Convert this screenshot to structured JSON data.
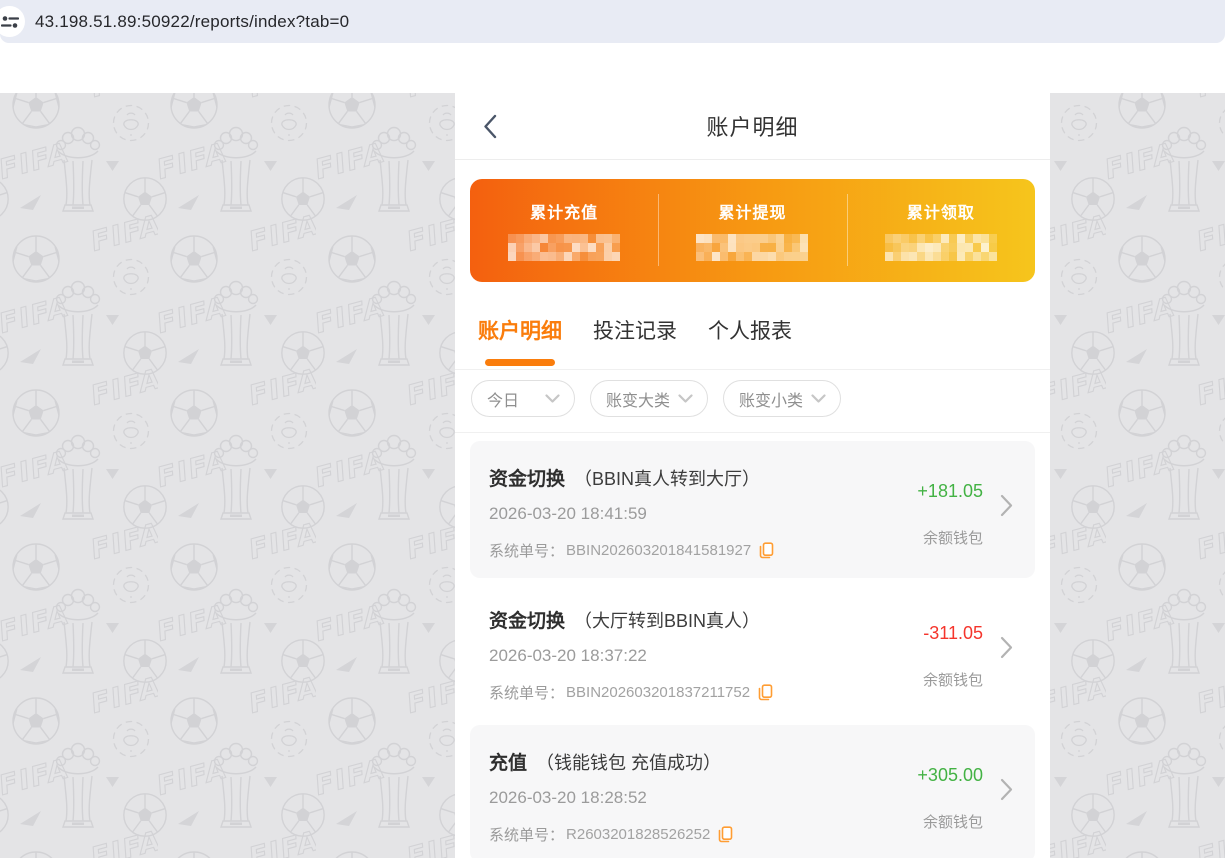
{
  "browser": {
    "url": "43.198.51.89:50922/reports/index?tab=0",
    "bar_color": "#e8ebf4"
  },
  "header": {
    "title": "账户明细"
  },
  "summary": {
    "items": [
      {
        "label": "累计充值",
        "value_redacted": true
      },
      {
        "label": "累计提现",
        "value_redacted": true
      },
      {
        "label": "累计领取",
        "value_redacted": true
      }
    ],
    "gradient_start": "#f4600f",
    "gradient_end": "#f6c51c"
  },
  "tabs": [
    {
      "label": "账户明细",
      "active": true
    },
    {
      "label": "投注记录",
      "active": false
    },
    {
      "label": "个人报表",
      "active": false
    }
  ],
  "filters": [
    {
      "label": "今日"
    },
    {
      "label": "账变大类"
    },
    {
      "label": "账变小类"
    }
  ],
  "transactions": [
    {
      "type": "资金切换",
      "detail": "（BBIN真人转到大厅）",
      "datetime": "2026-03-20 18:41:59",
      "order_label": "系统单号：",
      "order_no": "BBIN202603201841581927",
      "amount": "+181.05",
      "amount_color": "#43b244",
      "wallet": "余额钱包"
    },
    {
      "type": "资金切换",
      "detail": "（大厅转到BBIN真人）",
      "datetime": "2026-03-20 18:37:22",
      "order_label": "系统单号：",
      "order_no": "BBIN202603201837211752",
      "amount": "-311.05",
      "amount_color": "#f5352c",
      "wallet": "余额钱包"
    },
    {
      "type": "充值",
      "detail": "（钱能钱包 充值成功）",
      "datetime": "2026-03-20 18:28:52",
      "order_label": "系统单号：",
      "order_no": "R2603201828526252",
      "amount": "+305.00",
      "amount_color": "#43b244",
      "wallet": "余额钱包"
    }
  ],
  "icons": {
    "site_settings": "tune-sliders",
    "back": "chevron-left",
    "dropdown": "chevron-down",
    "copy": "copy-document",
    "row_arrow": "chevron-right"
  },
  "colors": {
    "accent": "#fa7d0c",
    "positive": "#43b244",
    "negative": "#f5352c",
    "watermark_bg": "#e4e4e6",
    "watermark_ink": "#d2d2d5"
  },
  "watermark": {
    "texts": [
      "FIFA"
    ],
    "motifs": [
      "trophy",
      "soccer-ball",
      "club-world-cup-emblem",
      "triangle",
      "wedge"
    ]
  }
}
